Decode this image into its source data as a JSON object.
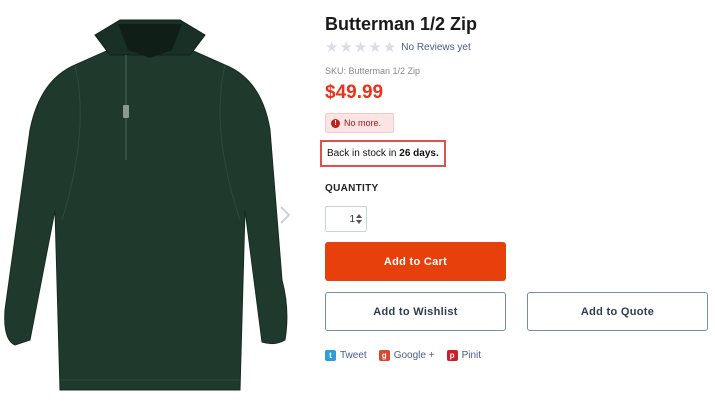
{
  "product": {
    "title": "Butterman 1/2 Zip",
    "stars_filled": 0,
    "stars_total": 5,
    "reviews_label": "No Reviews yet",
    "sku": "SKU: Butterman 1/2 Zip",
    "price": "$49.99",
    "stock_alert": "No more.",
    "restock": {
      "prefix": "Back in stock in",
      "days": "26 days."
    }
  },
  "quantity": {
    "label": "QUANTITY",
    "value": "1"
  },
  "buttons": {
    "add_to_cart": "Add to Cart",
    "add_to_wishlist": "Add to Wishlist",
    "add_to_quote": "Add to Quote"
  },
  "share": {
    "tweet": "Tweet",
    "google": "Google +",
    "pinit": "Pinit"
  },
  "colors": {
    "price": "#e8331c",
    "cart_button": "#e8400c",
    "jacket": "#1f3a2d",
    "highlight_border": "#e05050"
  },
  "icons": {
    "star": "star-icon",
    "alert": "alert-icon",
    "twitter": "twitter-icon",
    "google_plus": "google-plus-icon",
    "pinterest": "pinterest-icon",
    "next": "chevron-right-icon"
  }
}
